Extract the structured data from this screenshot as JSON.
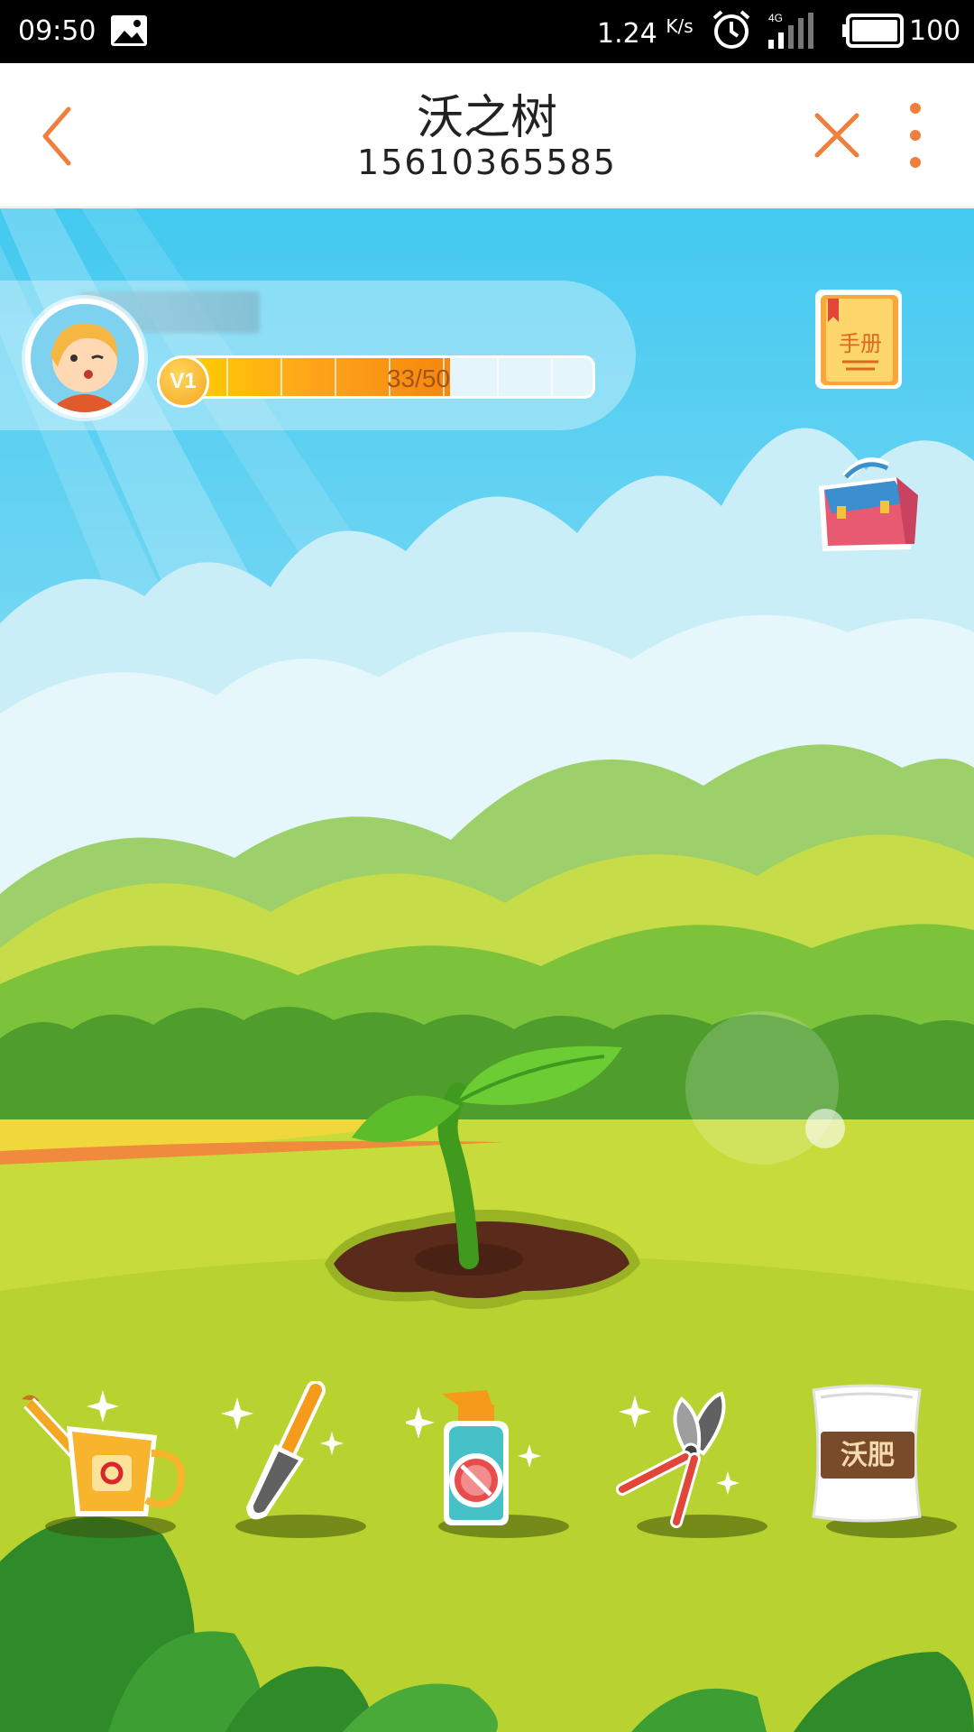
{
  "status_bar": {
    "time": "09:50",
    "net_speed": "1.24",
    "net_speed_unit": "K/s",
    "network": "4G",
    "battery": "100"
  },
  "header": {
    "title": "沃之树",
    "subtitle": "15610365585"
  },
  "player": {
    "level": "V1",
    "xp_text": "33/50",
    "xp_current": 33,
    "xp_max": 50
  },
  "side_buttons": {
    "handbook_label": "手册"
  },
  "tools": {
    "fertilizer_label": "沃肥"
  },
  "colors": {
    "accent": "#f07f3c",
    "sky": "#43c9f0",
    "grass": "#c7dc3a",
    "xp_fill": "#ffa51a"
  }
}
